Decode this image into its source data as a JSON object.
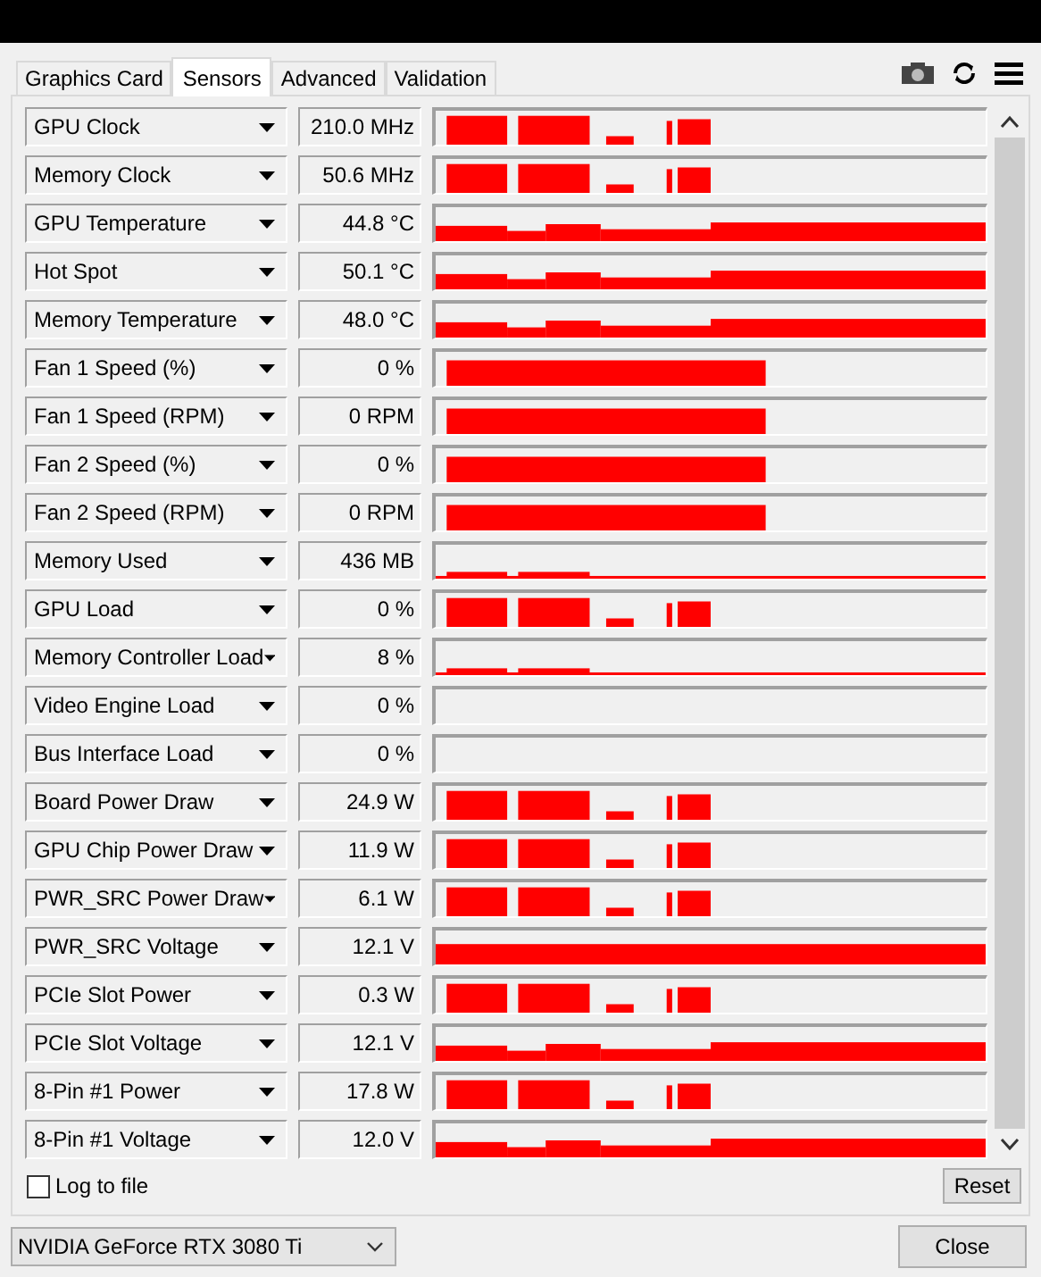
{
  "tabs": [
    {
      "label": "Graphics Card",
      "selected": false
    },
    {
      "label": "Sensors",
      "selected": true
    },
    {
      "label": "Advanced",
      "selected": false
    },
    {
      "label": "Validation",
      "selected": false
    }
  ],
  "sensors": [
    {
      "name": "GPU Clock",
      "value": "210.0 MHz",
      "kind": "bursts"
    },
    {
      "name": "Memory Clock",
      "value": "50.6 MHz",
      "kind": "bursts"
    },
    {
      "name": "GPU Temperature",
      "value": "44.8 °C",
      "kind": "steady"
    },
    {
      "name": "Hot Spot",
      "value": "50.1 °C",
      "kind": "steady"
    },
    {
      "name": "Memory Temperature",
      "value": "48.0 °C",
      "kind": "steady"
    },
    {
      "name": "Fan 1 Speed (%)",
      "value": "0 %",
      "kind": "plateau"
    },
    {
      "name": "Fan 1 Speed (RPM)",
      "value": "0 RPM",
      "kind": "plateau"
    },
    {
      "name": "Fan 2 Speed (%)",
      "value": "0 %",
      "kind": "plateau"
    },
    {
      "name": "Fan 2 Speed (RPM)",
      "value": "0 RPM",
      "kind": "plateau"
    },
    {
      "name": "Memory Used",
      "value": "436 MB",
      "kind": "low"
    },
    {
      "name": "GPU Load",
      "value": "0 %",
      "kind": "bursts"
    },
    {
      "name": "Memory Controller Load",
      "value": "8 %",
      "kind": "low"
    },
    {
      "name": "Video Engine Load",
      "value": "0 %",
      "kind": "empty"
    },
    {
      "name": "Bus Interface Load",
      "value": "0 %",
      "kind": "empty"
    },
    {
      "name": "Board Power Draw",
      "value": "24.9 W",
      "kind": "bursts"
    },
    {
      "name": "GPU Chip Power Draw",
      "value": "11.9 W",
      "kind": "bursts"
    },
    {
      "name": "PWR_SRC Power Draw",
      "value": "6.1 W",
      "kind": "bursts"
    },
    {
      "name": "PWR_SRC Voltage",
      "value": "12.1 V",
      "kind": "full"
    },
    {
      "name": "PCIe Slot Power",
      "value": "0.3 W",
      "kind": "bursts"
    },
    {
      "name": "PCIe Slot Voltage",
      "value": "12.1 V",
      "kind": "steady"
    },
    {
      "name": "8-Pin #1 Power",
      "value": "17.8 W",
      "kind": "bursts"
    },
    {
      "name": "8-Pin #1 Voltage",
      "value": "12.0 V",
      "kind": "steady"
    }
  ],
  "log_to_file": {
    "label": "Log to file",
    "checked": false
  },
  "reset_button": "Reset",
  "device_select": {
    "value": "NVIDIA GeForce RTX 3080 Ti"
  },
  "close_button": "Close"
}
